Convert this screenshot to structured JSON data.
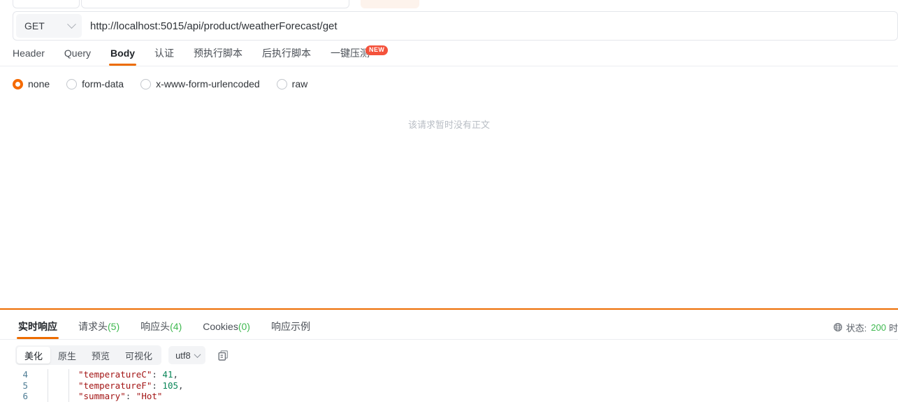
{
  "topstrip": {
    "partial_input_a": "",
    "partial_input_b": "",
    "partial_button": ""
  },
  "url_bar": {
    "method": "GET",
    "method_chevron_icon": "chevron-down-icon",
    "url": "http://localhost:5015/api/product/weatherForecast/get"
  },
  "request_tabs": [
    {
      "label": "Header",
      "active": false,
      "badge": ""
    },
    {
      "label": "Query",
      "active": false,
      "badge": ""
    },
    {
      "label": "Body",
      "active": true,
      "badge": ""
    },
    {
      "label": "认证",
      "active": false,
      "badge": ""
    },
    {
      "label": "预执行脚本",
      "active": false,
      "badge": ""
    },
    {
      "label": "后执行脚本",
      "active": false,
      "badge": ""
    },
    {
      "label": "一键压测",
      "active": false,
      "badge": "NEW"
    }
  ],
  "body_types": [
    {
      "label": "none",
      "selected": true
    },
    {
      "label": "form-data",
      "selected": false
    },
    {
      "label": "x-www-form-urlencoded",
      "selected": false
    },
    {
      "label": "raw",
      "selected": false
    }
  ],
  "empty_body_hint": "该请求暂时没有正文",
  "response_tabs": [
    {
      "label": "实时响应",
      "count": "",
      "active": true
    },
    {
      "label": "请求头",
      "count": "(5)",
      "active": false
    },
    {
      "label": "响应头",
      "count": "(4)",
      "active": false
    },
    {
      "label": "Cookies",
      "count": "(0)",
      "active": false
    },
    {
      "label": "响应示例",
      "count": "",
      "active": false
    }
  ],
  "status": {
    "globe_icon": "globe-icon",
    "label": "状态:",
    "code": "200",
    "truncated_next": "时"
  },
  "format_toolbar": {
    "segments": [
      {
        "label": "美化",
        "active": true
      },
      {
        "label": "原生",
        "active": false
      },
      {
        "label": "预览",
        "active": false
      },
      {
        "label": "可视化",
        "active": false
      }
    ],
    "encoding": "utf8",
    "encoding_chevron_icon": "chevron-down-icon",
    "copy_icon": "copy-icon"
  },
  "code": {
    "lines": [
      {
        "no": "4",
        "key": "\"temperatureC\"",
        "sep": ": ",
        "value": "41",
        "value_type": "num",
        "tail": ","
      },
      {
        "no": "5",
        "key": "\"temperatureF\"",
        "sep": ": ",
        "value": "105",
        "value_type": "num",
        "tail": ","
      },
      {
        "no": "6",
        "key": "\"summary\"",
        "sep": ": ",
        "value": "\"Hot\"",
        "value_type": "str",
        "tail": ""
      }
    ]
  },
  "colors": {
    "accent_orange": "#ed6c00",
    "radio_orange": "#f56a00",
    "badge_red": "#f4523b",
    "count_green": "#3fb950",
    "status_green": "#3fb950",
    "code_key": "#a31515",
    "code_num": "#098658",
    "line_number": "#4f7d95"
  }
}
